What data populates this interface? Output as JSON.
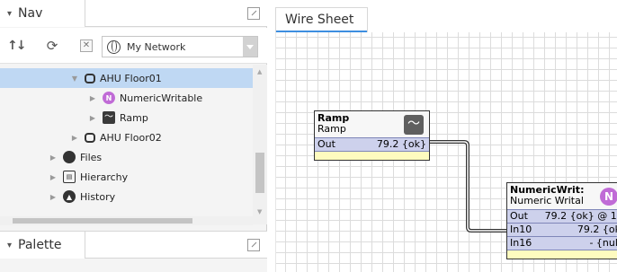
{
  "nav": {
    "title": "Nav",
    "network_select": "My Network",
    "tree": [
      {
        "label": "AHU Floor01",
        "icon": "device-icon",
        "expanded": true,
        "selected": true
      },
      {
        "label": "NumericWritable",
        "icon": "numeric-writable-icon",
        "expanded": false
      },
      {
        "label": "Ramp",
        "icon": "ramp-icon",
        "expanded": false
      },
      {
        "label": "AHU Floor02",
        "icon": "device-icon",
        "expanded": false
      },
      {
        "label": "Files",
        "icon": "files-icon",
        "expanded": false
      },
      {
        "label": "Hierarchy",
        "icon": "hierarchy-icon",
        "expanded": false
      },
      {
        "label": "History",
        "icon": "history-icon",
        "expanded": false
      }
    ]
  },
  "palette": {
    "title": "Palette"
  },
  "wiresheet": {
    "tab_label": "Wire Sheet",
    "ramp": {
      "title": "Ramp",
      "subtitle": "Ramp",
      "slots": [
        {
          "name": "Out",
          "value": "79.2 {ok}"
        }
      ]
    },
    "numeric_writable": {
      "title": "NumericWrit:",
      "subtitle": "Numeric Writal",
      "icon_letter": "N",
      "slots": [
        {
          "name": "Out",
          "value": "79.2 {ok} @ 1("
        },
        {
          "name": "In10",
          "value": "79.2 {ok"
        },
        {
          "name": "In16",
          "value": "- {null"
        }
      ]
    }
  },
  "colors": {
    "selection": "#bfd8f3",
    "slot_bg": "#cdd1ec",
    "footer_bg": "#fefbbf",
    "tab_underline": "#3d8ee0",
    "numeric_icon": "#c06bd6"
  }
}
